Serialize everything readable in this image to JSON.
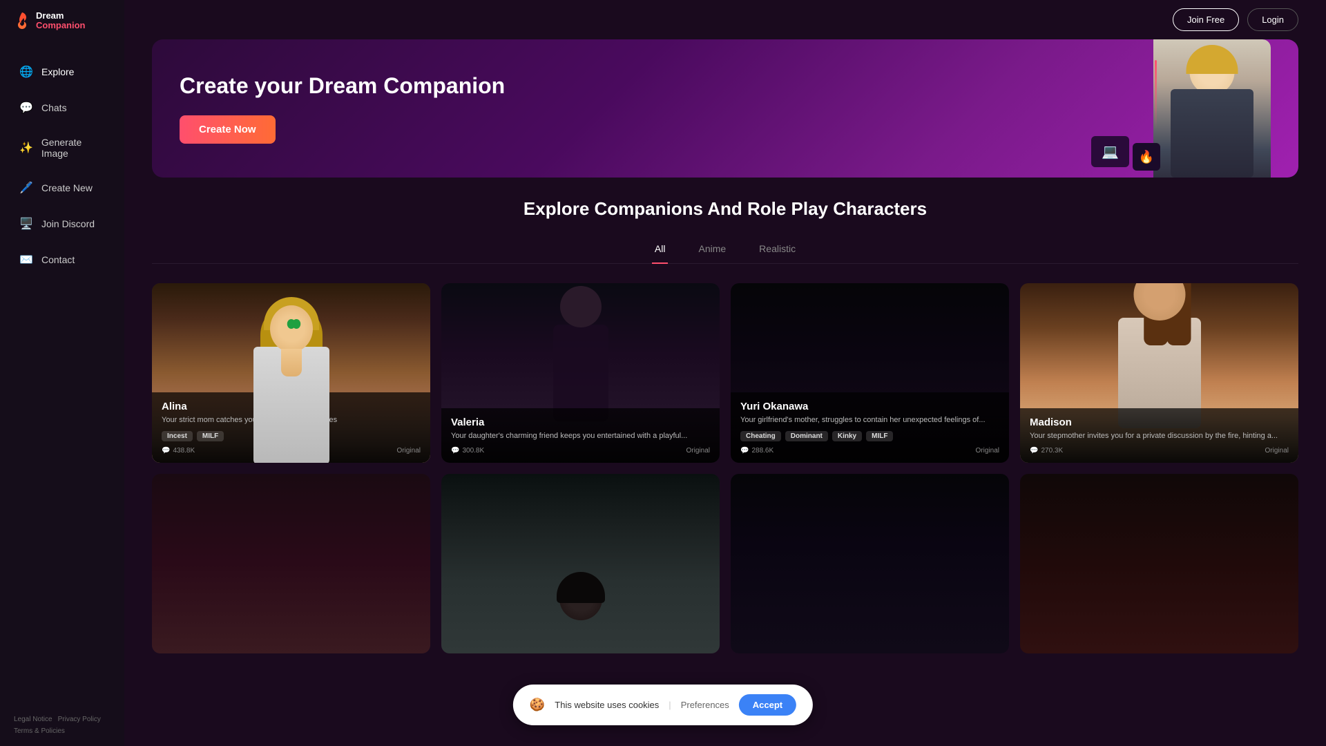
{
  "app": {
    "name": "Dream Companion",
    "logo_dream": "Dream",
    "logo_companion": "Companion"
  },
  "header": {
    "join_free_label": "Join Free",
    "login_label": "Login"
  },
  "sidebar": {
    "items": [
      {
        "id": "explore",
        "label": "Explore",
        "icon": "🌐"
      },
      {
        "id": "chats",
        "label": "Chats",
        "icon": "💬"
      },
      {
        "id": "generate-image",
        "label": "Generate Image",
        "icon": "✨"
      },
      {
        "id": "create-new",
        "label": "Create New",
        "icon": "🖊️"
      },
      {
        "id": "join-discord",
        "label": "Join Discord",
        "icon": "🖥️"
      },
      {
        "id": "contact",
        "label": "Contact",
        "icon": "✉️"
      }
    ],
    "footer_links": [
      {
        "label": "Legal Notice"
      },
      {
        "label": "Privacy Policy"
      },
      {
        "label": "Terms & Policies"
      }
    ]
  },
  "hero": {
    "title": "Create your Dream Companion",
    "create_now_label": "Create Now"
  },
  "explore": {
    "section_title": "Explore Companions And Role Play Characters",
    "tabs": [
      {
        "id": "all",
        "label": "All",
        "active": true
      },
      {
        "id": "anime",
        "label": "Anime",
        "active": false
      },
      {
        "id": "realistic",
        "label": "Realistic",
        "active": false
      }
    ],
    "cards": [
      {
        "id": "alina",
        "name": "Alina",
        "description": "Your strict mom catches you watching @dult movies",
        "tags": [
          "Incest",
          "MILF"
        ],
        "count": "438.8K",
        "badge": "Original",
        "style": "anime"
      },
      {
        "id": "valeria",
        "name": "Valeria",
        "description": "Your daughter's charming friend keeps you entertained with a playful...",
        "tags": [],
        "count": "300.8K",
        "badge": "Original",
        "style": "dark"
      },
      {
        "id": "yuri-okanawa",
        "name": "Yuri Okanawa",
        "description": "Your girlfriend's mother, struggles to contain her unexpected feelings of...",
        "tags": [
          "Cheating",
          "Dominant",
          "Kinky",
          "MILF"
        ],
        "count": "288.6K",
        "badge": "Original",
        "style": "dark"
      },
      {
        "id": "madison",
        "name": "Madison",
        "description": "Your stepmother invites you for a private discussion by the fire, hinting a...",
        "tags": [],
        "count": "270.3K",
        "badge": "Original",
        "style": "realistic"
      }
    ],
    "row2_cards": [
      {
        "id": "row2-1",
        "style": "dark1"
      },
      {
        "id": "row2-2",
        "style": "dark2"
      },
      {
        "id": "row2-3",
        "style": "dark3"
      },
      {
        "id": "row2-4",
        "style": "dark4"
      }
    ]
  },
  "cookie": {
    "text": "This website uses cookies",
    "divider": "|",
    "preferences_label": "Preferences",
    "accept_label": "Accept"
  }
}
